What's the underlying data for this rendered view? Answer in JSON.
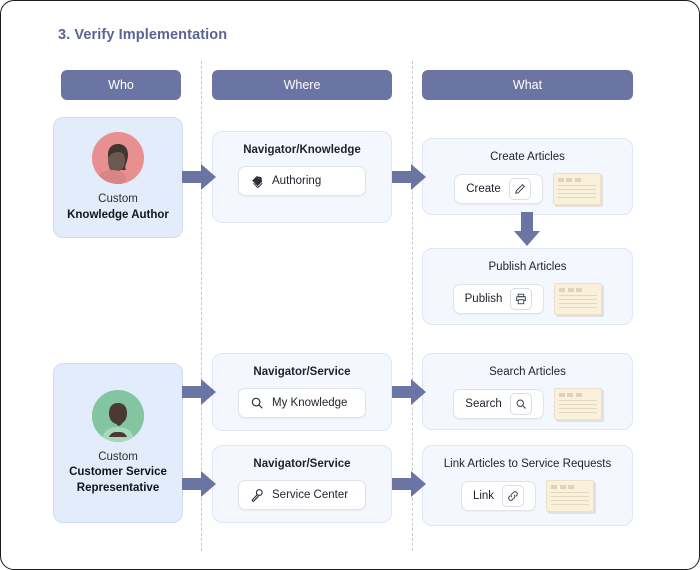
{
  "title": "3. Verify Implementation",
  "accent_color": "#6b75a3",
  "columns": [
    {
      "id": "who",
      "label": "Who"
    },
    {
      "id": "where",
      "label": "Where"
    },
    {
      "id": "what",
      "label": "What"
    }
  ],
  "personas": [
    {
      "id": "knowledge-author",
      "prefix": "Custom",
      "role": "Knowledge Author",
      "avatar_icon": "person-avatar-icon",
      "avatar_color": "#e89090"
    },
    {
      "id": "customer-service-representative",
      "prefix": "Custom",
      "role": "Customer Service Representative",
      "avatar_icon": "person-avatar-icon",
      "avatar_color": "#82c5a0"
    }
  ],
  "where_cards": [
    {
      "id": "authoring",
      "title": "Navigator/Knowledge",
      "chip_label": "Authoring",
      "chip_icon": "layers-tag-icon"
    },
    {
      "id": "my-knowledge",
      "title": "Navigator/Service",
      "chip_label": "My Knowledge",
      "chip_icon": "search-icon"
    },
    {
      "id": "service-center",
      "title": "Navigator/Service",
      "chip_label": "Service Center",
      "chip_icon": "wrench-icon"
    }
  ],
  "what_cards": [
    {
      "id": "create-articles",
      "title": "Create Articles",
      "chip_label": "Create",
      "chip_icon": "pencil-icon",
      "thumbnail": "article-thumbnail"
    },
    {
      "id": "publish-articles",
      "title": "Publish Articles",
      "chip_label": "Publish",
      "chip_icon": "printer-icon",
      "thumbnail": "article-thumbnail"
    },
    {
      "id": "search-articles",
      "title": "Search Articles",
      "chip_label": "Search",
      "chip_icon": "search-icon",
      "thumbnail": "article-thumbnail"
    },
    {
      "id": "link-articles",
      "title": "Link Articles to Service Requests",
      "chip_label": "Link",
      "chip_icon": "link-icon",
      "thumbnail": "article-thumbnail"
    }
  ]
}
